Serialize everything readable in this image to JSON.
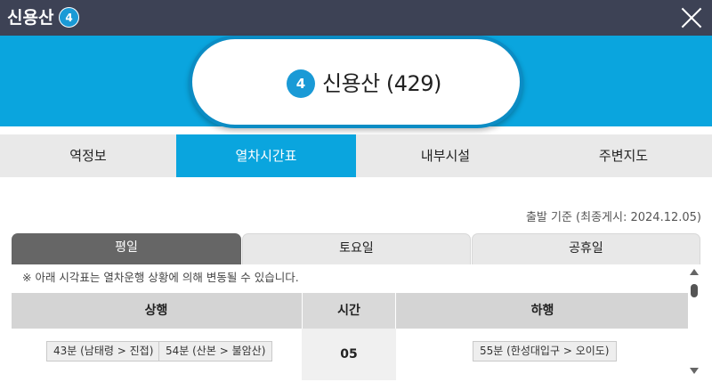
{
  "window": {
    "title": "신용산",
    "line_number": "4",
    "line_color": "#1a9ad6"
  },
  "station": {
    "line_number": "4",
    "name": "신용산 (429)"
  },
  "tabs": [
    {
      "label": "역정보",
      "active": false
    },
    {
      "label": "열차시간표",
      "active": true
    },
    {
      "label": "내부시설",
      "active": false
    },
    {
      "label": "주변지도",
      "active": false
    }
  ],
  "timetable": {
    "basis_text": "출발 기준 (최종게시: 2024.12.05)",
    "day_tabs": [
      {
        "label": "평일",
        "active": true
      },
      {
        "label": "토요일",
        "active": false
      },
      {
        "label": "공휴일",
        "active": false
      }
    ],
    "notice": "※ 아래 시각표는 열차운행 상황에 의해 변동될 수 있습니다.",
    "headers": {
      "up": "상행",
      "hour": "시간",
      "down": "하행"
    },
    "rows": [
      {
        "hour": "05",
        "up": [
          "43분 (남태령 > 진접)",
          "54분 (산본 > 불암산)"
        ],
        "down": [
          "55분 (한성대입구 > 오이도)"
        ]
      }
    ]
  },
  "colors": {
    "titlebar": "#3d4255",
    "accent": "#0aa5de",
    "active_day_tab": "#666666"
  }
}
